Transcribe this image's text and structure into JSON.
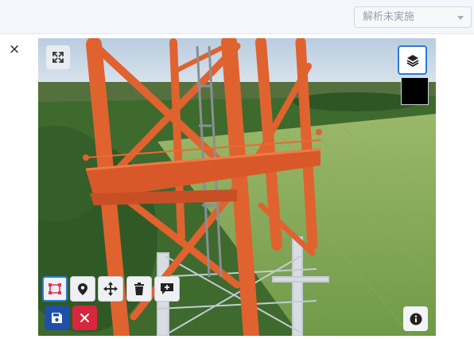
{
  "header": {
    "analysis_status_select": {
      "value": "解析未実施"
    }
  },
  "dialog": {
    "close_label": "×"
  },
  "viewer": {
    "toolbar": {
      "tools": [
        {
          "icon": "polygon-select-icon"
        },
        {
          "icon": "map-pin-icon"
        },
        {
          "icon": "move-arrows-icon"
        },
        {
          "icon": "trash-icon"
        },
        {
          "icon": "comment-add-icon"
        }
      ],
      "save_icon": "floppy-disk-icon",
      "cancel_icon": "x-icon"
    },
    "fullscreen_icon": "expand-arrows-icon",
    "layers_icon": "layers-icon",
    "info_icon": "info-icon",
    "colors": {
      "tower": "#e0622f",
      "save": "#1f4fa8",
      "cancel": "#d7263d",
      "active_border": "#2b7cd3",
      "select_icon": "#e3344f"
    }
  }
}
